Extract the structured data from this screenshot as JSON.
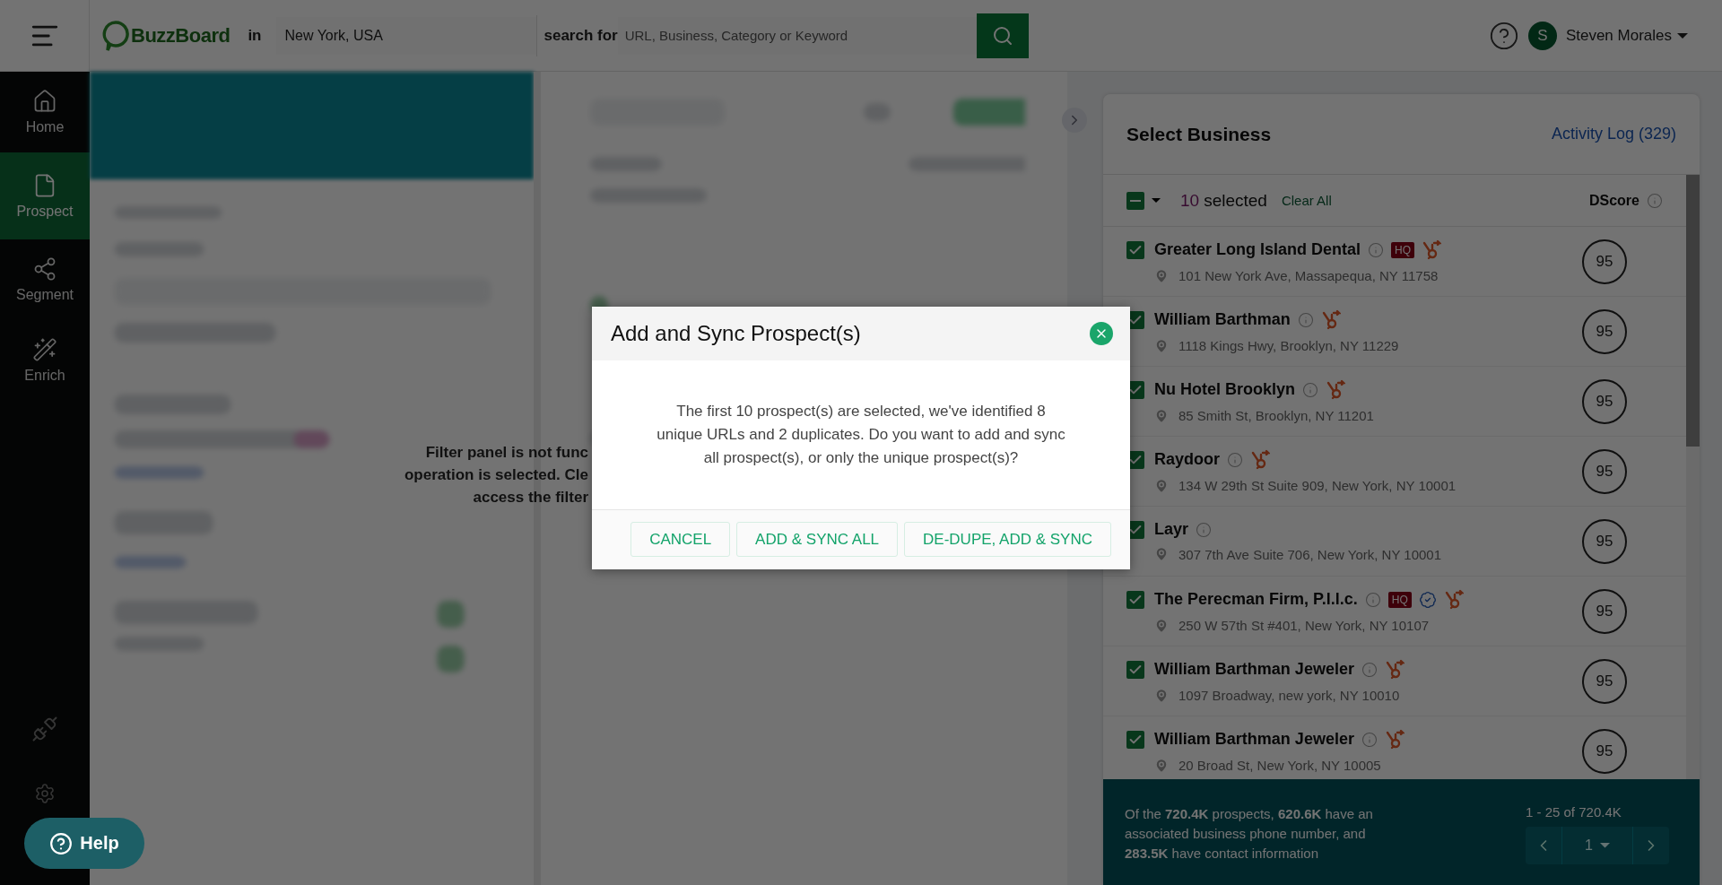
{
  "header": {
    "brand": "BuzzBoard",
    "location_label": "in",
    "location": "New York, USA",
    "search_label": "search for",
    "search_placeholder": "URL, Business, Category or Keyword",
    "user": {
      "initial": "S",
      "name": "Steven Morales"
    }
  },
  "sidebar": {
    "items": [
      {
        "label": "Home",
        "selected": false
      },
      {
        "label": "Prospect",
        "selected": true
      },
      {
        "label": "Segment",
        "selected": false
      },
      {
        "label": "Enrich",
        "selected": false
      }
    ]
  },
  "filter_notice": [
    "Filter panel is not func",
    "operation is selected. Cle",
    "access the filter"
  ],
  "select_business": {
    "title": "Select Business",
    "activity_log": "Activity Log (329)",
    "indeterminate": true,
    "selected_count": "10",
    "selected_label": "selected",
    "clear_all": "Clear All",
    "dscore_label": "DScore",
    "rows": [
      {
        "name": "Greater Long Island Dental",
        "address": "101 New York Ave, Massapequa, NY 11758",
        "checked": true,
        "badge": "HQ",
        "verified": false,
        "score": "95"
      },
      {
        "name": "William Barthman",
        "address": "1118 Kings Hwy, Brooklyn, NY 11229",
        "checked": true,
        "verified": false,
        "score": "95"
      },
      {
        "name": "Nu Hotel Brooklyn",
        "address": "85 Smith St, Brooklyn, NY 11201",
        "checked": true,
        "verified": false,
        "score": "95"
      },
      {
        "name": "Raydoor",
        "address": "134 W 29th St Suite 909, New York, NY 10001",
        "checked": true,
        "verified": false,
        "score": "95"
      },
      {
        "name": "Layr",
        "address": "307 7th Ave Suite 706, New York, NY 10001",
        "checked": true,
        "verified": false,
        "crm": false,
        "score": "95"
      },
      {
        "name": "The Perecman Firm, P.l.l.c.",
        "address": "250 W 57th St #401, New York, NY 10107",
        "checked": true,
        "badge": "HQ",
        "verified": true,
        "score": "95"
      },
      {
        "name": "William Barthman Jeweler",
        "address": "1097 Broadway, new york, NY 10010",
        "checked": true,
        "verified": false,
        "score": "95"
      },
      {
        "name": "William Barthman Jeweler",
        "address": "20 Broad St, New York, NY 10005",
        "checked": true,
        "verified": false,
        "score": "95"
      }
    ],
    "summary": "Of the **720.4K** prospects, **620.6K** have an associated business phone number, and **283.5K** have contact information",
    "range": "1 - 25 of 720.4K",
    "page": "1"
  },
  "modal": {
    "title": "Add and Sync Prospect(s)",
    "message": "The first 10 prospect(s) are selected, we've identified 8 unique URLs and 2 duplicates. Do you want to add and sync all prospect(s), or only the unique prospect(s)?",
    "buttons": [
      "CANCEL",
      "ADD & SYNC ALL",
      "DE-DUPE, ADD & SYNC"
    ]
  },
  "help": {
    "label": "Help"
  }
}
